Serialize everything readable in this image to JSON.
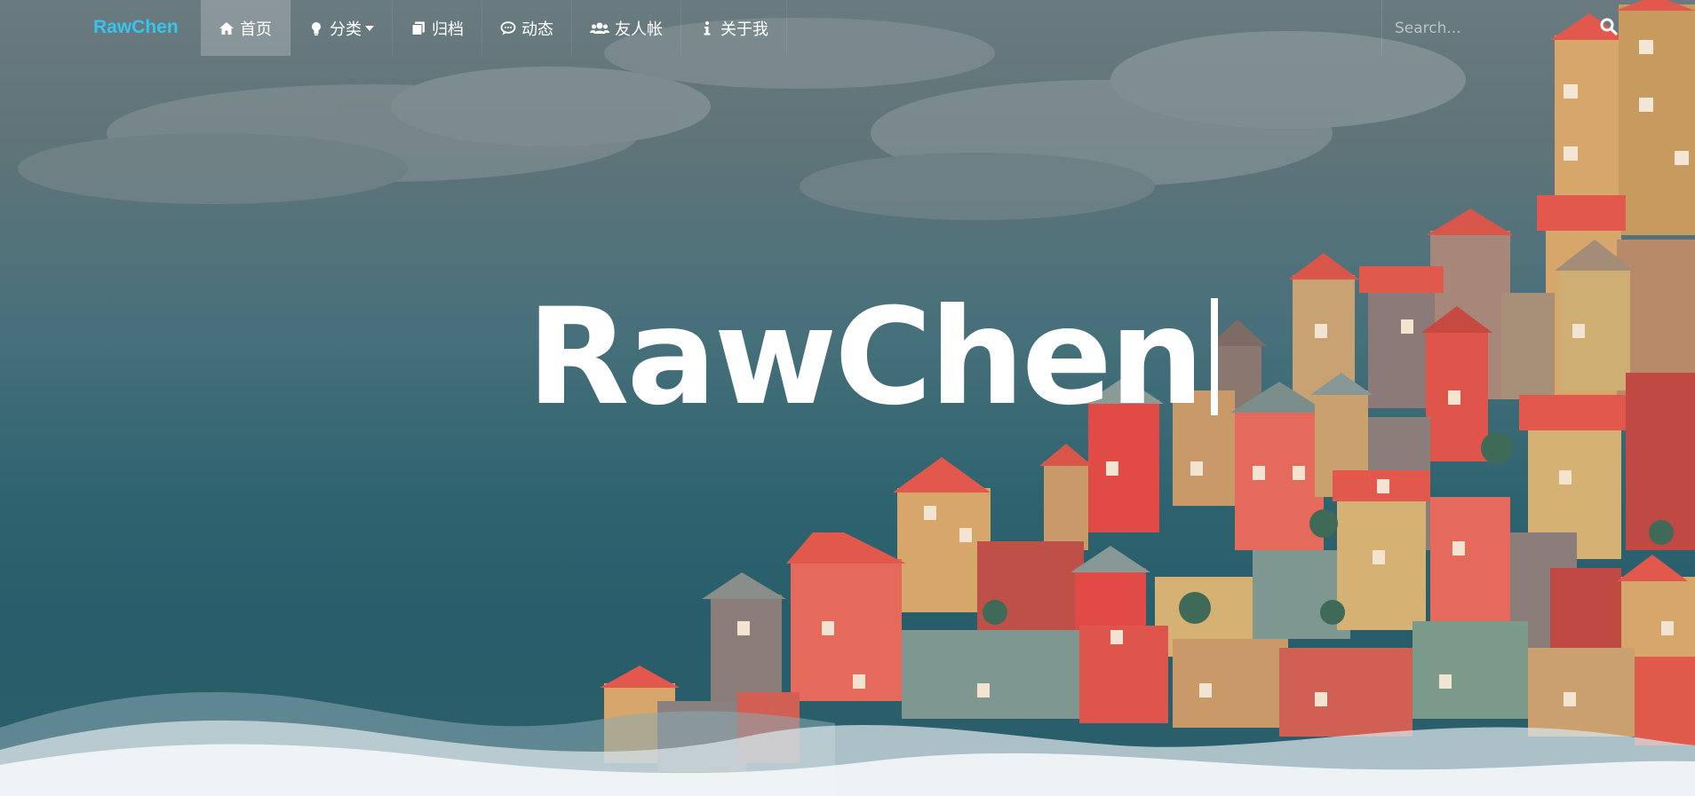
{
  "site": {
    "brand": "RawChen",
    "hero_title": "RawChen"
  },
  "nav": {
    "items": [
      {
        "label": "首页",
        "icon": "home-icon",
        "active": true
      },
      {
        "label": "分类",
        "icon": "lightbulb-icon",
        "dropdown": true
      },
      {
        "label": "归档",
        "icon": "files-icon"
      },
      {
        "label": "动态",
        "icon": "comment-icon"
      },
      {
        "label": "友人帐",
        "icon": "users-icon"
      },
      {
        "label": "关于我",
        "icon": "info-icon"
      }
    ]
  },
  "search": {
    "placeholder": "Search...",
    "icon": "search-icon"
  },
  "colors": {
    "brand": "#36c4ec",
    "nav_text": "#ffffff",
    "sky": "#5f7479",
    "sea": "#2b5f6b",
    "roof_red": "#e2584c",
    "wall_pink": "#e66a5c",
    "wall_yellow": "#d7a66a",
    "wall_teal": "#6e9a88",
    "wave": "#f2f6f8"
  }
}
